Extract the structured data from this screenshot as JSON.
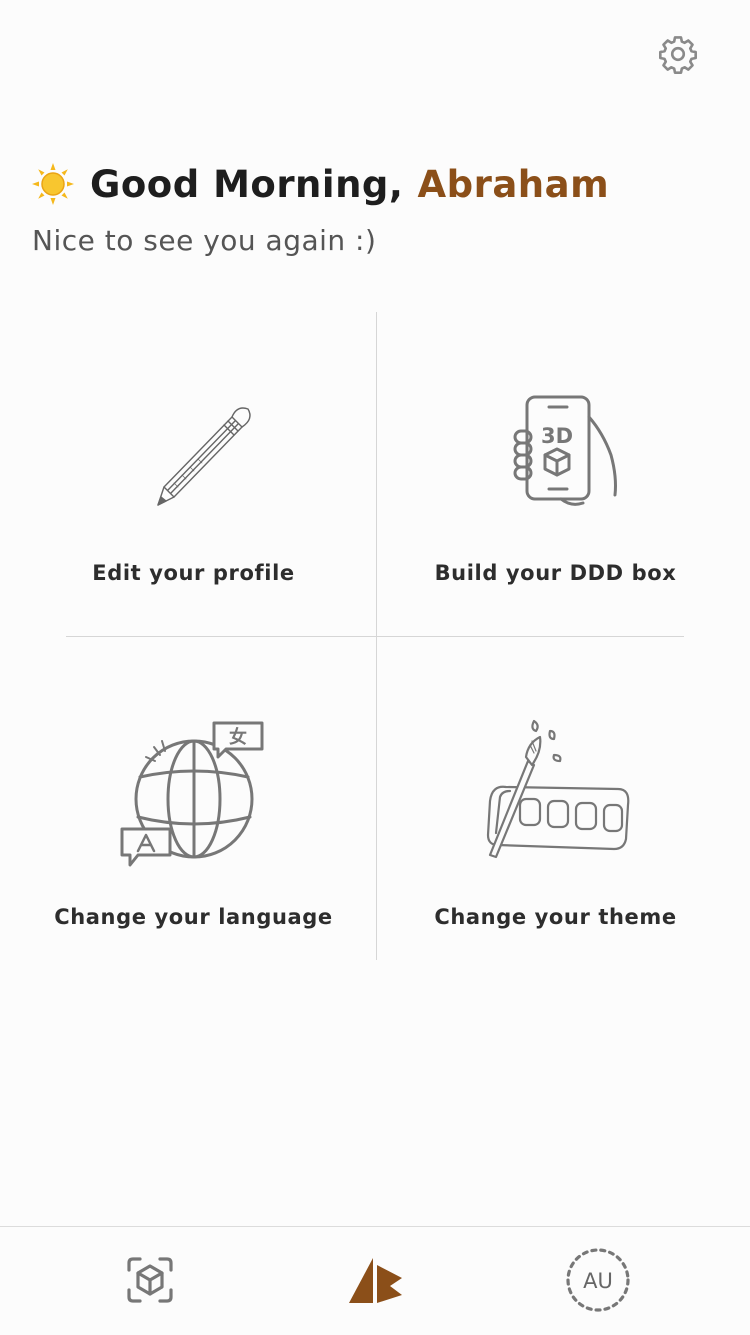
{
  "greeting": {
    "prefix": "Good Morning,",
    "name": "Abraham",
    "subtitle": "Nice to see you again :)",
    "icon": "sun-icon"
  },
  "header": {
    "settings_icon": "gear-icon"
  },
  "tiles": [
    {
      "label": "Edit your profile",
      "icon": "pencil-icon"
    },
    {
      "label": "Build your DDD box",
      "icon": "phone-3d-icon"
    },
    {
      "label": "Change your language",
      "icon": "globe-translate-icon"
    },
    {
      "label": "Change your theme",
      "icon": "paint-palette-icon"
    }
  ],
  "bottom_nav": {
    "items": [
      {
        "icon": "ar-cube-icon"
      },
      {
        "icon": "app-logo-icon"
      },
      {
        "icon": "avatar-icon",
        "initials": "AU"
      }
    ]
  },
  "colors": {
    "accent": "#8b4f19",
    "sun": "#f5b81c",
    "line": "#d6d6d6",
    "icon": "#7a7a7a"
  }
}
